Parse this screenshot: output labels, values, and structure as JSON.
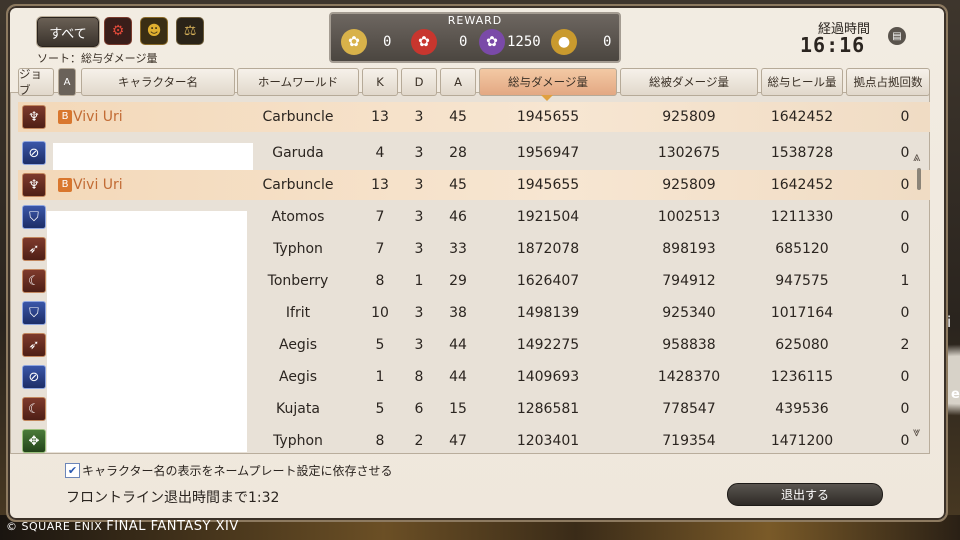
{
  "filter": {
    "all_label": "すべて",
    "gc_icons": [
      "maelstrom-icon",
      "twin-adder-icon",
      "immortal-flames-icon"
    ],
    "sort_label": "ソート：総与ダメージ量"
  },
  "reward": {
    "title": "REWARD",
    "items": [
      {
        "icon": "gold-seal-icon",
        "value": "0",
        "color": "#d8b24a"
      },
      {
        "icon": "red-seal-icon",
        "value": "0",
        "color": "#c8362e"
      },
      {
        "icon": "purple-seal-icon",
        "value": "1250",
        "color": "#7a4aa8"
      },
      {
        "icon": "medal-icon",
        "value": "0",
        "color": "#c99a2e"
      }
    ]
  },
  "elapsed": {
    "label": "経過時間",
    "time": "16:16"
  },
  "columns": {
    "job": "ジョブ",
    "a_badge": "A",
    "name": "キャラクター名",
    "world": "ホームワールド",
    "k": "K",
    "d": "D",
    "a": "A",
    "damage_dealt": "総与ダメージ量",
    "damage_taken": "総被ダメージ量",
    "healing": "総与ヒール量",
    "occupations": "拠点占拠回数"
  },
  "pinned_row": {
    "job_color": "red",
    "job_glyph": "♆",
    "name": "Vivi Uri",
    "badge": "B",
    "world": "Carbuncle",
    "k": "13",
    "d": "3",
    "a": "45",
    "dmg": "1945655",
    "taken": "925809",
    "heal": "1642452",
    "occ": "0"
  },
  "rows": [
    {
      "job_color": "blue",
      "job_glyph": "⊘",
      "name": "",
      "badge": "",
      "world": "Garuda",
      "k": "4",
      "d": "3",
      "a": "28",
      "dmg": "1956947",
      "taken": "1302675",
      "heal": "1538728",
      "occ": "0",
      "me": false
    },
    {
      "job_color": "red",
      "job_glyph": "♆",
      "name": "Vivi Uri",
      "badge": "B",
      "world": "Carbuncle",
      "k": "13",
      "d": "3",
      "a": "45",
      "dmg": "1945655",
      "taken": "925809",
      "heal": "1642452",
      "occ": "0",
      "me": true
    },
    {
      "job_color": "blue",
      "job_glyph": "⛉",
      "name": "",
      "badge": "",
      "world": "Atomos",
      "k": "7",
      "d": "3",
      "a": "46",
      "dmg": "1921504",
      "taken": "1002513",
      "heal": "1211330",
      "occ": "0",
      "me": false
    },
    {
      "job_color": "red",
      "job_glyph": "➶",
      "name": "",
      "badge": "",
      "world": "Typhon",
      "k": "7",
      "d": "3",
      "a": "33",
      "dmg": "1872078",
      "taken": "898193",
      "heal": "685120",
      "occ": "0",
      "me": false
    },
    {
      "job_color": "red",
      "job_glyph": "☾",
      "name": "",
      "badge": "",
      "world": "Tonberry",
      "k": "8",
      "d": "1",
      "a": "29",
      "dmg": "1626407",
      "taken": "794912",
      "heal": "947575",
      "occ": "1",
      "me": false
    },
    {
      "job_color": "blue",
      "job_glyph": "⛉",
      "name": "",
      "badge": "",
      "world": "Ifrit",
      "k": "10",
      "d": "3",
      "a": "38",
      "dmg": "1498139",
      "taken": "925340",
      "heal": "1017164",
      "occ": "0",
      "me": false
    },
    {
      "job_color": "red",
      "job_glyph": "➶",
      "name": "",
      "badge": "",
      "world": "Aegis",
      "k": "5",
      "d": "3",
      "a": "44",
      "dmg": "1492275",
      "taken": "958838",
      "heal": "625080",
      "occ": "2",
      "me": false
    },
    {
      "job_color": "blue",
      "job_glyph": "⊘",
      "name": "",
      "badge": "",
      "world": "Aegis",
      "k": "1",
      "d": "8",
      "a": "44",
      "dmg": "1409693",
      "taken": "1428370",
      "heal": "1236115",
      "occ": "0",
      "me": false
    },
    {
      "job_color": "red",
      "job_glyph": "☾",
      "name": "",
      "badge": "",
      "world": "Kujata",
      "k": "5",
      "d": "6",
      "a": "15",
      "dmg": "1286581",
      "taken": "778547",
      "heal": "439536",
      "occ": "0",
      "me": false
    },
    {
      "job_color": "green",
      "job_glyph": "✥",
      "name": "",
      "badge": "",
      "world": "Typhon",
      "k": "8",
      "d": "2",
      "a": "47",
      "dmg": "1203401",
      "taken": "719354",
      "heal": "1471200",
      "occ": "0",
      "me": false
    }
  ],
  "footer": {
    "checkbox_label": "キャラクター名の表示をネームプレート設定に依存させる",
    "checkbox_checked": true,
    "timer_label": "フロントライン退出時間まで1:32",
    "leave_button": "退出する"
  },
  "copyright": {
    "company": "© SQUARE ENIX",
    "title": "FINAL FANTASY XIV"
  },
  "side": {
    "text1": "i",
    "text2": "e"
  }
}
